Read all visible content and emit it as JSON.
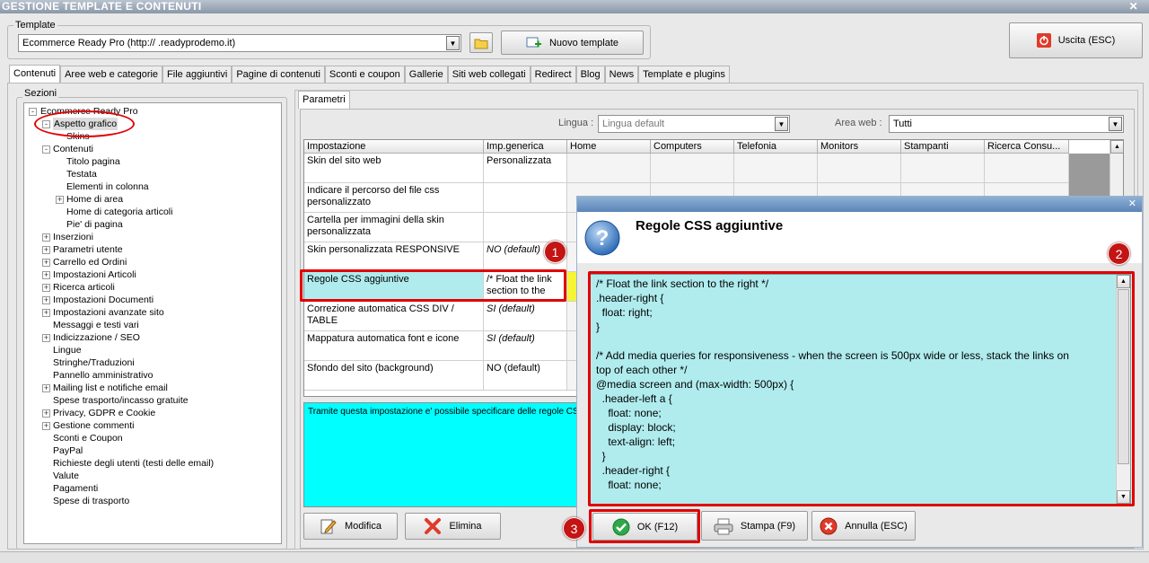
{
  "window": {
    "title": "GESTIONE TEMPLATE E CONTENUTI"
  },
  "template": {
    "group_label": "Template",
    "selected": "Ecommerce Ready Pro (http://      .readyprodemo.it)",
    "new_button": "Nuovo template",
    "exit_button": "Uscita (ESC)"
  },
  "tabs": [
    "Contenuti",
    "Aree web e categorie",
    "File aggiuntivi",
    "Pagine di contenuti",
    "Sconti e coupon",
    "Gallerie",
    "Siti web collegati",
    "Redirect",
    "Blog",
    "News",
    "Template e plugins"
  ],
  "sections": {
    "label": "Sezioni",
    "root": "Ecommerce Ready Pro",
    "items": [
      {
        "label": "Aspetto grafico",
        "level": 1,
        "expander": "-"
      },
      {
        "label": "Skins",
        "level": 2,
        "expander": ""
      },
      {
        "label": "Contenuti",
        "level": 1,
        "expander": "-"
      },
      {
        "label": "Titolo pagina",
        "level": 2,
        "expander": ""
      },
      {
        "label": "Testata",
        "level": 2,
        "expander": ""
      },
      {
        "label": "Elementi in colonna",
        "level": 2,
        "expander": ""
      },
      {
        "label": "Home di area",
        "level": 2,
        "expander": "+"
      },
      {
        "label": "Home di categoria articoli",
        "level": 2,
        "expander": ""
      },
      {
        "label": "Pie' di pagina",
        "level": 2,
        "expander": ""
      },
      {
        "label": "Inserzioni",
        "level": 1,
        "expander": "+"
      },
      {
        "label": "Parametri utente",
        "level": 1,
        "expander": "+"
      },
      {
        "label": "Carrello ed Ordini",
        "level": 1,
        "expander": "+"
      },
      {
        "label": "Impostazioni Articoli",
        "level": 1,
        "expander": "+"
      },
      {
        "label": "Ricerca articoli",
        "level": 1,
        "expander": "+"
      },
      {
        "label": "Impostazioni Documenti",
        "level": 1,
        "expander": "+"
      },
      {
        "label": "Impostazioni avanzate sito",
        "level": 1,
        "expander": "+"
      },
      {
        "label": "Messaggi e testi vari",
        "level": 1,
        "expander": ""
      },
      {
        "label": "Indicizzazione / SEO",
        "level": 1,
        "expander": "+"
      },
      {
        "label": "Lingue",
        "level": 1,
        "expander": ""
      },
      {
        "label": "Stringhe/Traduzioni",
        "level": 1,
        "expander": ""
      },
      {
        "label": "Pannello amministrativo",
        "level": 1,
        "expander": ""
      },
      {
        "label": "Mailing list e notifiche email",
        "level": 1,
        "expander": "+"
      },
      {
        "label": "Spese trasporto/incasso gratuite",
        "level": 1,
        "expander": ""
      },
      {
        "label": "Privacy, GDPR e Cookie",
        "level": 1,
        "expander": "+"
      },
      {
        "label": "Gestione commenti",
        "level": 1,
        "expander": "+"
      },
      {
        "label": "Sconti e Coupon",
        "level": 1,
        "expander": ""
      },
      {
        "label": "PayPal",
        "level": 1,
        "expander": ""
      },
      {
        "label": "Richieste degli utenti (testi delle email)",
        "level": 1,
        "expander": ""
      },
      {
        "label": "Valute",
        "level": 1,
        "expander": ""
      },
      {
        "label": "Pagamenti",
        "level": 1,
        "expander": ""
      },
      {
        "label": "Spese di trasporto",
        "level": 1,
        "expander": ""
      }
    ]
  },
  "params": {
    "tab": "Parametri",
    "lingua_label": "Lingua :",
    "lingua_value": "Lingua default",
    "area_label": "Area web :",
    "area_value": "Tutti",
    "columns": [
      "Impostazione",
      "Imp.generica",
      "Home",
      "Computers",
      "Telefonia",
      "Monitors",
      "Stampanti",
      "Ricerca Consu..."
    ],
    "rows": [
      {
        "name": "Skin del sito web",
        "value": "Personalizzata",
        "italic": false
      },
      {
        "name": "Indicare il percorso del file css personalizzato",
        "value": "",
        "italic": false
      },
      {
        "name": "Cartella per immagini della skin personalizzata",
        "value": "",
        "italic": false
      },
      {
        "name": "Skin personalizzata RESPONSIVE",
        "value": "NO (default)",
        "italic": true
      },
      {
        "name": "Regole CSS aggiuntive",
        "value": "/* Float the link section to the",
        "italic": false
      },
      {
        "name": "Correzione automatica CSS DIV / TABLE",
        "value": "SI (default)",
        "italic": true
      },
      {
        "name": "Mappatura automatica font e icone",
        "value": "SI (default)",
        "italic": true
      },
      {
        "name": "Sfondo del sito (background)",
        "value": "NO (default)",
        "italic": false
      }
    ],
    "description": "Tramite questa impostazione e' possibile specificare delle regole CSS",
    "modify_button": "Modifica",
    "delete_button": "Elimina"
  },
  "dialog": {
    "title": "Regole CSS aggiuntive",
    "code": "/* Float the link section to the right */\n.header-right {\n  float: right;\n}\n\n/* Add media queries for responsiveness - when the screen is 500px wide or less, stack the links on\ntop of each other */\n@media screen and (max-width: 500px) {\n  .header-left a {\n    float: none;\n    display: block;\n    text-align: left;\n  }\n  .header-right {\n    float: none;",
    "ok_button": "OK (F12)",
    "print_button": "Stampa (F9)",
    "cancel_button": "Annulla (ESC)"
  },
  "badges": [
    "1",
    "2",
    "3"
  ]
}
